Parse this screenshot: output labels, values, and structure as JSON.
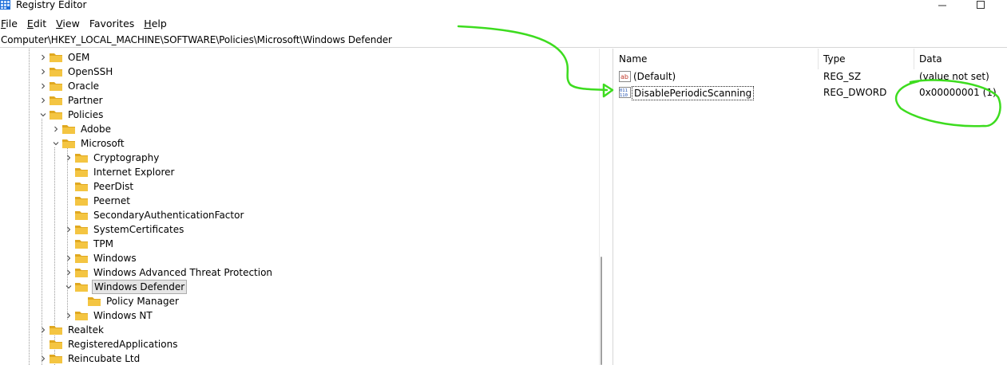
{
  "window": {
    "title": "Registry Editor"
  },
  "menu": [
    {
      "label": "File",
      "accel": "F",
      "rest": "ile"
    },
    {
      "label": "Edit",
      "accel": "E",
      "rest": "dit"
    },
    {
      "label": "View",
      "accel": "V",
      "rest": "iew"
    },
    {
      "label": "Favorites",
      "accel": "",
      "rest": "Favorites"
    },
    {
      "label": "Help",
      "accel": "H",
      "rest": "elp"
    }
  ],
  "address": {
    "path": "Computer\\HKEY_LOCAL_MACHINE\\SOFTWARE\\Policies\\Microsoft\\Windows Defender"
  },
  "tree": {
    "items": [
      {
        "label": "OEM",
        "depth": 0,
        "expander": "collapsed"
      },
      {
        "label": "OpenSSH",
        "depth": 0,
        "expander": "collapsed"
      },
      {
        "label": "Oracle",
        "depth": 0,
        "expander": "collapsed"
      },
      {
        "label": "Partner",
        "depth": 0,
        "expander": "collapsed"
      },
      {
        "label": "Policies",
        "depth": 0,
        "expander": "expanded"
      },
      {
        "label": "Adobe",
        "depth": 1,
        "expander": "collapsed"
      },
      {
        "label": "Microsoft",
        "depth": 1,
        "expander": "expanded"
      },
      {
        "label": "Cryptography",
        "depth": 2,
        "expander": "collapsed"
      },
      {
        "label": "Internet Explorer",
        "depth": 2,
        "expander": "none"
      },
      {
        "label": "PeerDist",
        "depth": 2,
        "expander": "none"
      },
      {
        "label": "Peernet",
        "depth": 2,
        "expander": "none"
      },
      {
        "label": "SecondaryAuthenticationFactor",
        "depth": 2,
        "expander": "none"
      },
      {
        "label": "SystemCertificates",
        "depth": 2,
        "expander": "collapsed"
      },
      {
        "label": "TPM",
        "depth": 2,
        "expander": "none"
      },
      {
        "label": "Windows",
        "depth": 2,
        "expander": "collapsed"
      },
      {
        "label": "Windows Advanced Threat Protection",
        "depth": 2,
        "expander": "collapsed"
      },
      {
        "label": "Windows Defender",
        "depth": 2,
        "expander": "expanded",
        "selected": true
      },
      {
        "label": "Policy Manager",
        "depth": 3,
        "expander": "none"
      },
      {
        "label": "Windows NT",
        "depth": 2,
        "expander": "collapsed"
      },
      {
        "label": "Realtek",
        "depth": 0,
        "expander": "collapsed"
      },
      {
        "label": "RegisteredApplications",
        "depth": 0,
        "expander": "none"
      },
      {
        "label": "Reincubate Ltd",
        "depth": 0,
        "expander": "collapsed"
      }
    ]
  },
  "values": {
    "columns": {
      "name": "Name",
      "type": "Type",
      "data": "Data"
    },
    "rows": [
      {
        "name": "(Default)",
        "type": "REG_SZ",
        "data": "(value not set)",
        "icon": "string-value-icon"
      },
      {
        "name": "DisablePeriodicScanning",
        "type": "REG_DWORD",
        "data": "0x00000001 (1)",
        "icon": "dword-value-icon",
        "focused": true
      }
    ]
  },
  "colors": {
    "folder": "#f4c542",
    "folder_dark": "#e0a820",
    "annotation": "#3ddc1f",
    "selection_bg": "#e5e5e5"
  }
}
